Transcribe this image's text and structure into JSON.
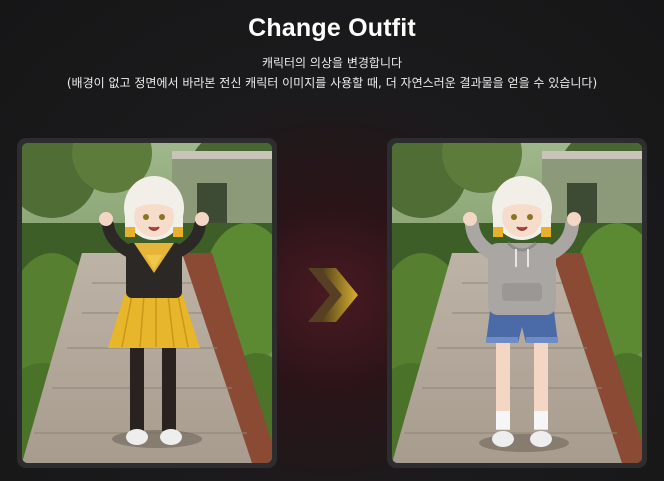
{
  "header": {
    "title": "Change Outfit",
    "subtitle_line1": "캐릭터의 의상을 변경합니다",
    "subtitle_line2": "(배경이 없고 정면에서 바라본 전신 캐릭터 이미지를 사용할 때, 더 자연스러운 결과물을 얻을 수 있습니다)"
  },
  "images": {
    "before": {
      "icon": "character-school-uniform-image",
      "outfit": "black sailor top, yellow pleated skirt, black stockings, white sneakers"
    },
    "after": {
      "icon": "character-hoodie-image",
      "outfit": "gray hoodie, blue denim shorts, white socks, white sneakers"
    }
  },
  "arrow": {
    "icon": "double-chevron-right-icon",
    "color": "#c9a227"
  },
  "colors": {
    "background": "#18181a",
    "accent_glow": "#5a1a24",
    "card": "#2d2d30"
  }
}
